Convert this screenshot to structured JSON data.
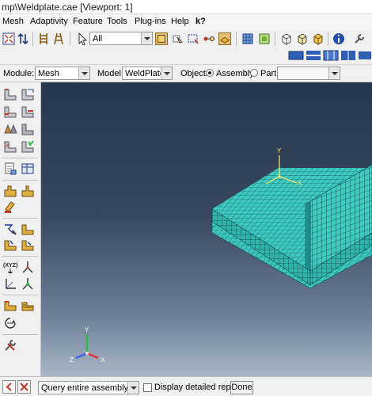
{
  "window": {
    "title": "mp\\Weldplate.cae [Viewport: 1]"
  },
  "menu": {
    "items": [
      "Mesh",
      "Adaptivity",
      "Feature",
      "Tools",
      "Plug-ins",
      "Help",
      "k?"
    ]
  },
  "toolbar": {
    "selection_filter": "All"
  },
  "context": {
    "module_label": "Module:",
    "module_value": "Mesh",
    "model_label": "Model:",
    "model_value": "WeldPlate",
    "object_label": "Object:",
    "assembly_label": "Assembly",
    "part_label": "Part:",
    "part_value": "",
    "object_selected": "Assembly"
  },
  "viewport": {
    "triad_labels": {
      "x": "X",
      "y": "Y",
      "z": "Z"
    },
    "local_axis": {
      "y": "Y",
      "x": "X"
    }
  },
  "prompt": {
    "query_value": "Query entire assembly",
    "detail_label": "Display detailed report",
    "detail_checked": false,
    "done_label": "Done"
  },
  "colors": {
    "mesh": "#3ec9c2",
    "mesh_dark": "#1e8f8c",
    "mesh_edge": "#0b4a48",
    "viewport_top": "#27374d",
    "viewport_bottom": "#a9b6c6",
    "triad_x": "#e23030",
    "triad_y": "#2fb84a",
    "triad_z": "#3a5ee0"
  },
  "icons": {
    "toolbar": [
      "fit-view-icon",
      "arrows-icon",
      "ladder-icon",
      "ladder-2-icon",
      "cursor-icon",
      "select-box-icon",
      "select-tool-icon",
      "box-select-icon",
      "drag-icon",
      "mesh-highlight-icon",
      "render-icon",
      "mesh-icon",
      "shaded-cube-icon",
      "wire-cube-icon",
      "iso-cube-icon",
      "solid-cube-icon",
      "info-icon",
      "wrench-icon",
      "blue-view-icon"
    ],
    "toolbox": [
      "seed-part-icon",
      "seed-edge-icon",
      "seed-by-number-icon",
      "seed-bias-icon",
      "mesh-controls-icon",
      "element-type-icon",
      "mesh-part-icon",
      "mesh-region-icon",
      "verify-icon",
      "query-icon",
      "partition-icon",
      "partition-face-icon",
      "virtual-topology-icon",
      "edit-mesh-icon",
      "create-set-icon",
      "create-node-icon",
      "xyz-icon",
      "node-triad-icon",
      "datum-csys-icon",
      "assign-orientation-icon",
      "offset-mesh-icon",
      "refine-icon",
      "stack-icon",
      "tools-icon"
    ]
  }
}
